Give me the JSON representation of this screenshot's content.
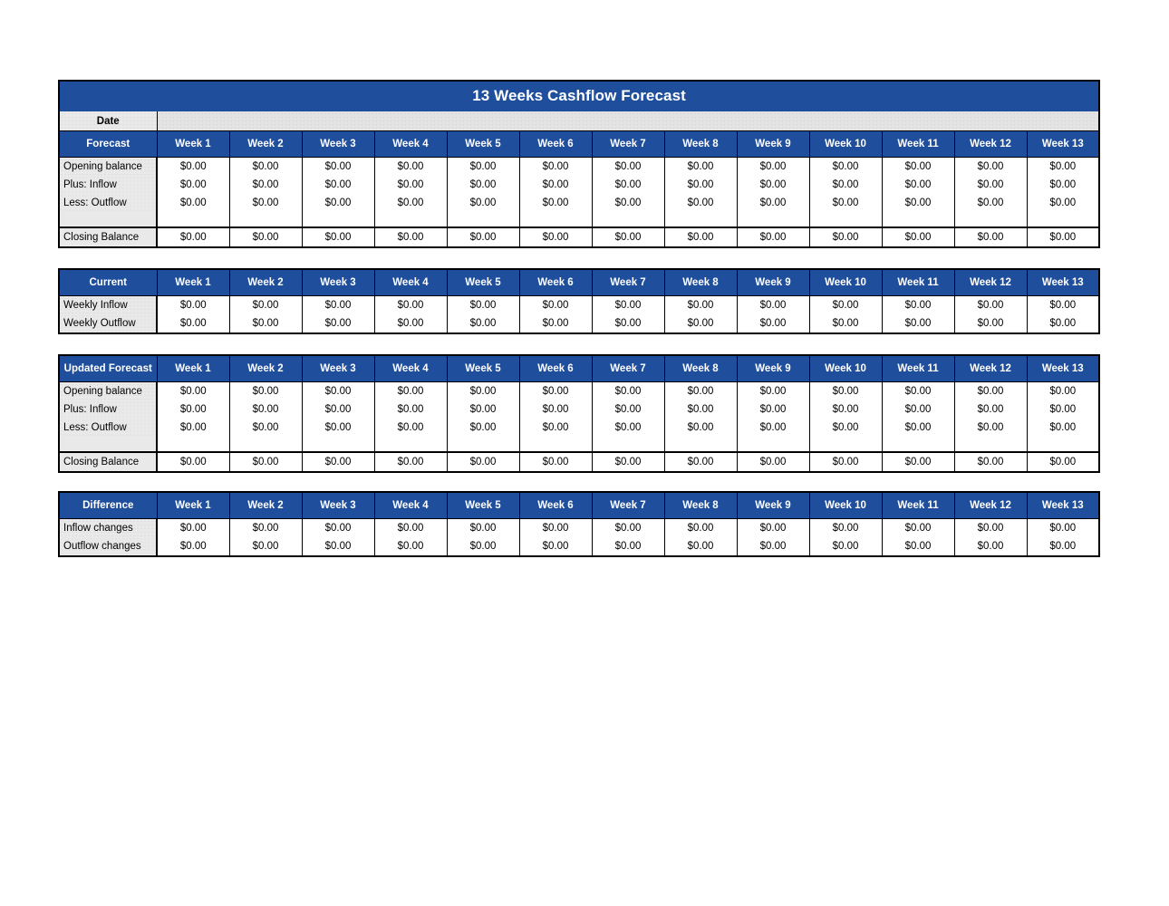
{
  "document": {
    "title": "13 Weeks Cashflow Forecast",
    "date_label": "Date",
    "date_value": ""
  },
  "colors": {
    "header_blue": "#1F4E9C",
    "label_gray": "#E9E9E9",
    "cell_white": "#FFFFFF",
    "border_black": "#000000",
    "header_text": "#FFFFFF"
  },
  "week_headers": [
    "Week 1",
    "Week 2",
    "Week 3",
    "Week 4",
    "Week 5",
    "Week 6",
    "Week 7",
    "Week 8",
    "Week 9",
    "Week 10",
    "Week 11",
    "Week 12",
    "Week 13"
  ],
  "zero": "$0.00",
  "blocks": [
    {
      "key": "forecast",
      "corner_label": "Forecast",
      "rows": [
        {
          "label": "Opening balance",
          "values": [
            "$0.00",
            "$0.00",
            "$0.00",
            "$0.00",
            "$0.00",
            "$0.00",
            "$0.00",
            "$0.00",
            "$0.00",
            "$0.00",
            "$0.00",
            "$0.00",
            "$0.00"
          ]
        },
        {
          "label": "Plus: Inflow",
          "values": [
            "$0.00",
            "$0.00",
            "$0.00",
            "$0.00",
            "$0.00",
            "$0.00",
            "$0.00",
            "$0.00",
            "$0.00",
            "$0.00",
            "$0.00",
            "$0.00",
            "$0.00"
          ]
        },
        {
          "label": "Less: Outflow",
          "values": [
            "$0.00",
            "$0.00",
            "$0.00",
            "$0.00",
            "$0.00",
            "$0.00",
            "$0.00",
            "$0.00",
            "$0.00",
            "$0.00",
            "$0.00",
            "$0.00",
            "$0.00"
          ]
        }
      ],
      "spacer": true,
      "total_row": {
        "label": "Closing Balance",
        "values": [
          "$0.00",
          "$0.00",
          "$0.00",
          "$0.00",
          "$0.00",
          "$0.00",
          "$0.00",
          "$0.00",
          "$0.00",
          "$0.00",
          "$0.00",
          "$0.00",
          "$0.00"
        ]
      }
    },
    {
      "key": "current",
      "corner_label": "Current",
      "rows": [
        {
          "label": "Weekly Inflow",
          "values": [
            "$0.00",
            "$0.00",
            "$0.00",
            "$0.00",
            "$0.00",
            "$0.00",
            "$0.00",
            "$0.00",
            "$0.00",
            "$0.00",
            "$0.00",
            "$0.00",
            "$0.00"
          ]
        },
        {
          "label": "Weekly Outflow",
          "values": [
            "$0.00",
            "$0.00",
            "$0.00",
            "$0.00",
            "$0.00",
            "$0.00",
            "$0.00",
            "$0.00",
            "$0.00",
            "$0.00",
            "$0.00",
            "$0.00",
            "$0.00"
          ]
        }
      ],
      "spacer": false,
      "total_row": null
    },
    {
      "key": "updated_forecast",
      "corner_label": "Updated Forecast",
      "rows": [
        {
          "label": "Opening balance",
          "values": [
            "$0.00",
            "$0.00",
            "$0.00",
            "$0.00",
            "$0.00",
            "$0.00",
            "$0.00",
            "$0.00",
            "$0.00",
            "$0.00",
            "$0.00",
            "$0.00",
            "$0.00"
          ]
        },
        {
          "label": "Plus: Inflow",
          "values": [
            "$0.00",
            "$0.00",
            "$0.00",
            "$0.00",
            "$0.00",
            "$0.00",
            "$0.00",
            "$0.00",
            "$0.00",
            "$0.00",
            "$0.00",
            "$0.00",
            "$0.00"
          ]
        },
        {
          "label": "Less: Outflow",
          "values": [
            "$0.00",
            "$0.00",
            "$0.00",
            "$0.00",
            "$0.00",
            "$0.00",
            "$0.00",
            "$0.00",
            "$0.00",
            "$0.00",
            "$0.00",
            "$0.00",
            "$0.00"
          ]
        }
      ],
      "spacer": true,
      "total_row": {
        "label": "Closing Balance",
        "values": [
          "$0.00",
          "$0.00",
          "$0.00",
          "$0.00",
          "$0.00",
          "$0.00",
          "$0.00",
          "$0.00",
          "$0.00",
          "$0.00",
          "$0.00",
          "$0.00",
          "$0.00"
        ]
      }
    },
    {
      "key": "difference",
      "corner_label": "Difference",
      "rows": [
        {
          "label": "Inflow changes",
          "values": [
            "$0.00",
            "$0.00",
            "$0.00",
            "$0.00",
            "$0.00",
            "$0.00",
            "$0.00",
            "$0.00",
            "$0.00",
            "$0.00",
            "$0.00",
            "$0.00",
            "$0.00"
          ]
        },
        {
          "label": "Outflow changes",
          "values": [
            "$0.00",
            "$0.00",
            "$0.00",
            "$0.00",
            "$0.00",
            "$0.00",
            "$0.00",
            "$0.00",
            "$0.00",
            "$0.00",
            "$0.00",
            "$0.00",
            "$0.00"
          ]
        }
      ],
      "spacer": false,
      "total_row": null
    }
  ]
}
